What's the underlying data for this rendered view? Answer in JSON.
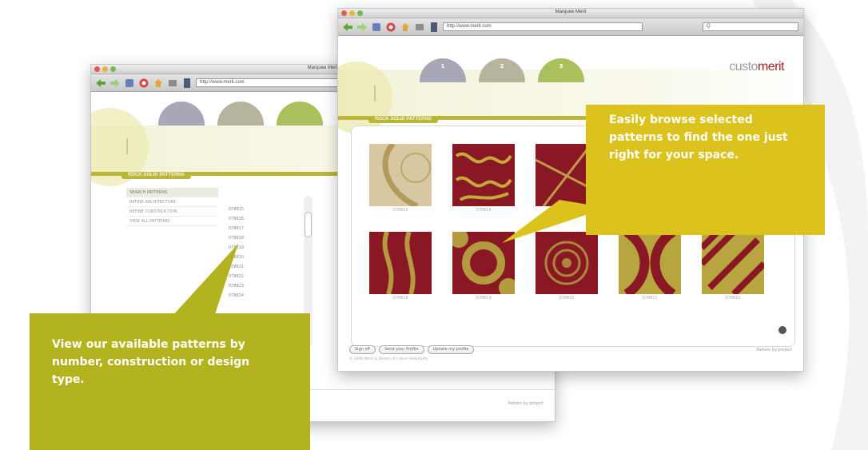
{
  "callouts": {
    "browse": "Easily browse selected patterns to find the one just right for your space.",
    "view": "View our available patterns by number, construction or design type."
  },
  "back_window": {
    "title": "Marquee Merit",
    "address": "http://www.merit.com",
    "section_label": "ROCK SOLID PATTERNS",
    "menu_items": [
      "SEARCH PATTERNS",
      "REFINE ARCHITECTURE",
      "REFINE CONSTRUCTION",
      "VIEW ALL PATTERNS"
    ],
    "pattern_numbers": [
      "078815",
      "078816",
      "078817",
      "078818",
      "078819",
      "078820",
      "078821",
      "078822",
      "078823",
      "078824"
    ],
    "footer_text": "Pattern by project"
  },
  "front_window": {
    "title": "Marquee Merit",
    "address": "http://www.merit.com",
    "search_hint": "Q",
    "logo_plain": "custo",
    "logo_accent": "merit",
    "section_label": "ROCK SOLID PATTERNS",
    "dome_numbers": [
      "1",
      "2",
      "3"
    ],
    "swatches": [
      {
        "label": "078815"
      },
      {
        "label": "078816"
      },
      {
        "label": "078817"
      },
      {
        "label": "078818"
      },
      {
        "label": "078819"
      },
      {
        "label": "078820"
      },
      {
        "label": "078821"
      },
      {
        "label": "078822"
      },
      {
        "label": "078823"
      }
    ],
    "footer_buttons": [
      "Sign off",
      "Send your Profile",
      "Update my profile"
    ],
    "copyright": "© 2006 Merit & Dream of Colors Hospitality",
    "footer_right": "Pattern by project"
  },
  "colors": {
    "yellow_callout": "#dcc21c",
    "green_callout": "#b2b31f",
    "olive_band": "#b9b63a",
    "burgundy": "#8a1724"
  }
}
